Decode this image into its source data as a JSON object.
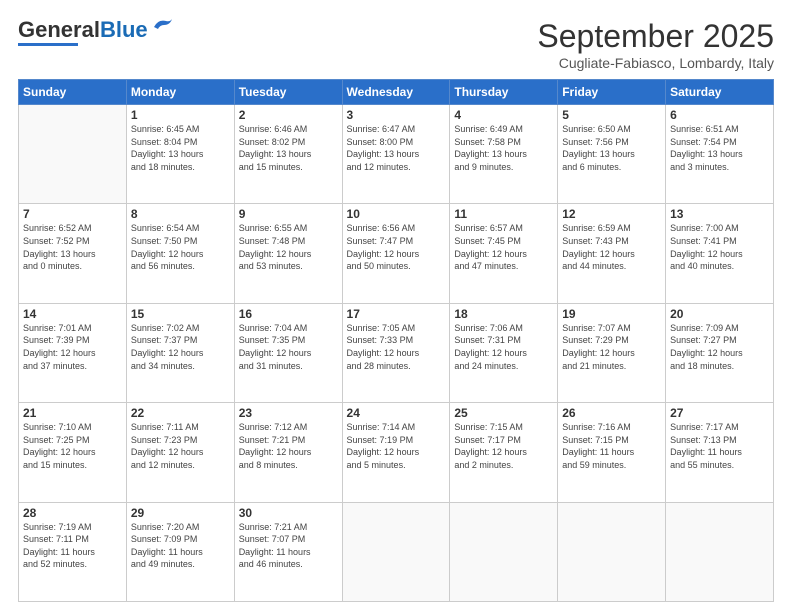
{
  "header": {
    "logo_general": "General",
    "logo_blue": "Blue",
    "month_title": "September 2025",
    "location": "Cugliate-Fabiasco, Lombardy, Italy"
  },
  "weekdays": [
    "Sunday",
    "Monday",
    "Tuesday",
    "Wednesday",
    "Thursday",
    "Friday",
    "Saturday"
  ],
  "weeks": [
    [
      {
        "day": "",
        "info": ""
      },
      {
        "day": "1",
        "info": "Sunrise: 6:45 AM\nSunset: 8:04 PM\nDaylight: 13 hours\nand 18 minutes."
      },
      {
        "day": "2",
        "info": "Sunrise: 6:46 AM\nSunset: 8:02 PM\nDaylight: 13 hours\nand 15 minutes."
      },
      {
        "day": "3",
        "info": "Sunrise: 6:47 AM\nSunset: 8:00 PM\nDaylight: 13 hours\nand 12 minutes."
      },
      {
        "day": "4",
        "info": "Sunrise: 6:49 AM\nSunset: 7:58 PM\nDaylight: 13 hours\nand 9 minutes."
      },
      {
        "day": "5",
        "info": "Sunrise: 6:50 AM\nSunset: 7:56 PM\nDaylight: 13 hours\nand 6 minutes."
      },
      {
        "day": "6",
        "info": "Sunrise: 6:51 AM\nSunset: 7:54 PM\nDaylight: 13 hours\nand 3 minutes."
      }
    ],
    [
      {
        "day": "7",
        "info": "Sunrise: 6:52 AM\nSunset: 7:52 PM\nDaylight: 13 hours\nand 0 minutes."
      },
      {
        "day": "8",
        "info": "Sunrise: 6:54 AM\nSunset: 7:50 PM\nDaylight: 12 hours\nand 56 minutes."
      },
      {
        "day": "9",
        "info": "Sunrise: 6:55 AM\nSunset: 7:48 PM\nDaylight: 12 hours\nand 53 minutes."
      },
      {
        "day": "10",
        "info": "Sunrise: 6:56 AM\nSunset: 7:47 PM\nDaylight: 12 hours\nand 50 minutes."
      },
      {
        "day": "11",
        "info": "Sunrise: 6:57 AM\nSunset: 7:45 PM\nDaylight: 12 hours\nand 47 minutes."
      },
      {
        "day": "12",
        "info": "Sunrise: 6:59 AM\nSunset: 7:43 PM\nDaylight: 12 hours\nand 44 minutes."
      },
      {
        "day": "13",
        "info": "Sunrise: 7:00 AM\nSunset: 7:41 PM\nDaylight: 12 hours\nand 40 minutes."
      }
    ],
    [
      {
        "day": "14",
        "info": "Sunrise: 7:01 AM\nSunset: 7:39 PM\nDaylight: 12 hours\nand 37 minutes."
      },
      {
        "day": "15",
        "info": "Sunrise: 7:02 AM\nSunset: 7:37 PM\nDaylight: 12 hours\nand 34 minutes."
      },
      {
        "day": "16",
        "info": "Sunrise: 7:04 AM\nSunset: 7:35 PM\nDaylight: 12 hours\nand 31 minutes."
      },
      {
        "day": "17",
        "info": "Sunrise: 7:05 AM\nSunset: 7:33 PM\nDaylight: 12 hours\nand 28 minutes."
      },
      {
        "day": "18",
        "info": "Sunrise: 7:06 AM\nSunset: 7:31 PM\nDaylight: 12 hours\nand 24 minutes."
      },
      {
        "day": "19",
        "info": "Sunrise: 7:07 AM\nSunset: 7:29 PM\nDaylight: 12 hours\nand 21 minutes."
      },
      {
        "day": "20",
        "info": "Sunrise: 7:09 AM\nSunset: 7:27 PM\nDaylight: 12 hours\nand 18 minutes."
      }
    ],
    [
      {
        "day": "21",
        "info": "Sunrise: 7:10 AM\nSunset: 7:25 PM\nDaylight: 12 hours\nand 15 minutes."
      },
      {
        "day": "22",
        "info": "Sunrise: 7:11 AM\nSunset: 7:23 PM\nDaylight: 12 hours\nand 12 minutes."
      },
      {
        "day": "23",
        "info": "Sunrise: 7:12 AM\nSunset: 7:21 PM\nDaylight: 12 hours\nand 8 minutes."
      },
      {
        "day": "24",
        "info": "Sunrise: 7:14 AM\nSunset: 7:19 PM\nDaylight: 12 hours\nand 5 minutes."
      },
      {
        "day": "25",
        "info": "Sunrise: 7:15 AM\nSunset: 7:17 PM\nDaylight: 12 hours\nand 2 minutes."
      },
      {
        "day": "26",
        "info": "Sunrise: 7:16 AM\nSunset: 7:15 PM\nDaylight: 11 hours\nand 59 minutes."
      },
      {
        "day": "27",
        "info": "Sunrise: 7:17 AM\nSunset: 7:13 PM\nDaylight: 11 hours\nand 55 minutes."
      }
    ],
    [
      {
        "day": "28",
        "info": "Sunrise: 7:19 AM\nSunset: 7:11 PM\nDaylight: 11 hours\nand 52 minutes."
      },
      {
        "day": "29",
        "info": "Sunrise: 7:20 AM\nSunset: 7:09 PM\nDaylight: 11 hours\nand 49 minutes."
      },
      {
        "day": "30",
        "info": "Sunrise: 7:21 AM\nSunset: 7:07 PM\nDaylight: 11 hours\nand 46 minutes."
      },
      {
        "day": "",
        "info": ""
      },
      {
        "day": "",
        "info": ""
      },
      {
        "day": "",
        "info": ""
      },
      {
        "day": "",
        "info": ""
      }
    ]
  ]
}
